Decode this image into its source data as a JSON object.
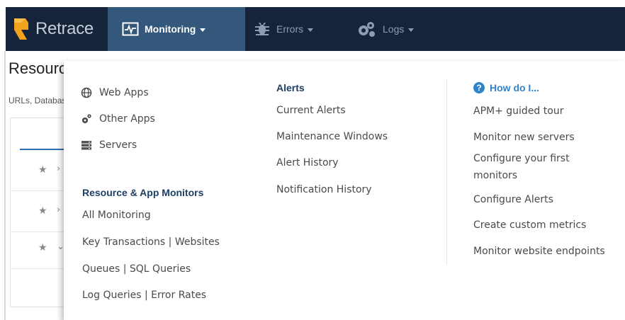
{
  "app": {
    "brand_name": "Retrace"
  },
  "nav": {
    "monitoring_label": "Monitoring",
    "errors_label": "Errors",
    "logs_label": "Logs"
  },
  "page": {
    "title": "Resources",
    "subtitle": "URLs, Databases"
  },
  "menu": {
    "apps": [
      {
        "label": "Web Apps",
        "icon": "globe-icon"
      },
      {
        "label": "Other Apps",
        "icon": "gears-icon"
      },
      {
        "label": "Servers",
        "icon": "server-icon"
      }
    ],
    "resource_heading": "Resource & App Monitors",
    "resource_links": [
      "All Monitoring",
      "Key Transactions | Websites",
      "Queues | SQL Queries",
      "Log Queries | Error Rates"
    ],
    "alerts_heading": "Alerts",
    "alerts_links": [
      "Current Alerts",
      "Maintenance Windows",
      "Alert History",
      "Notification History"
    ],
    "help_heading": "How do I...",
    "help_links": [
      "APM+ guided tour",
      "Monitor new servers",
      "Configure your first",
      "monitors",
      "Configure Alerts",
      "Create custom metrics",
      "Monitor website endpoints"
    ]
  },
  "colors": {
    "nav_bg": "#15243a",
    "nav_active": "#34587c",
    "heading": "#1d3e63",
    "help_accent": "#2f83c9",
    "brand_logo": "#f2a31c"
  }
}
